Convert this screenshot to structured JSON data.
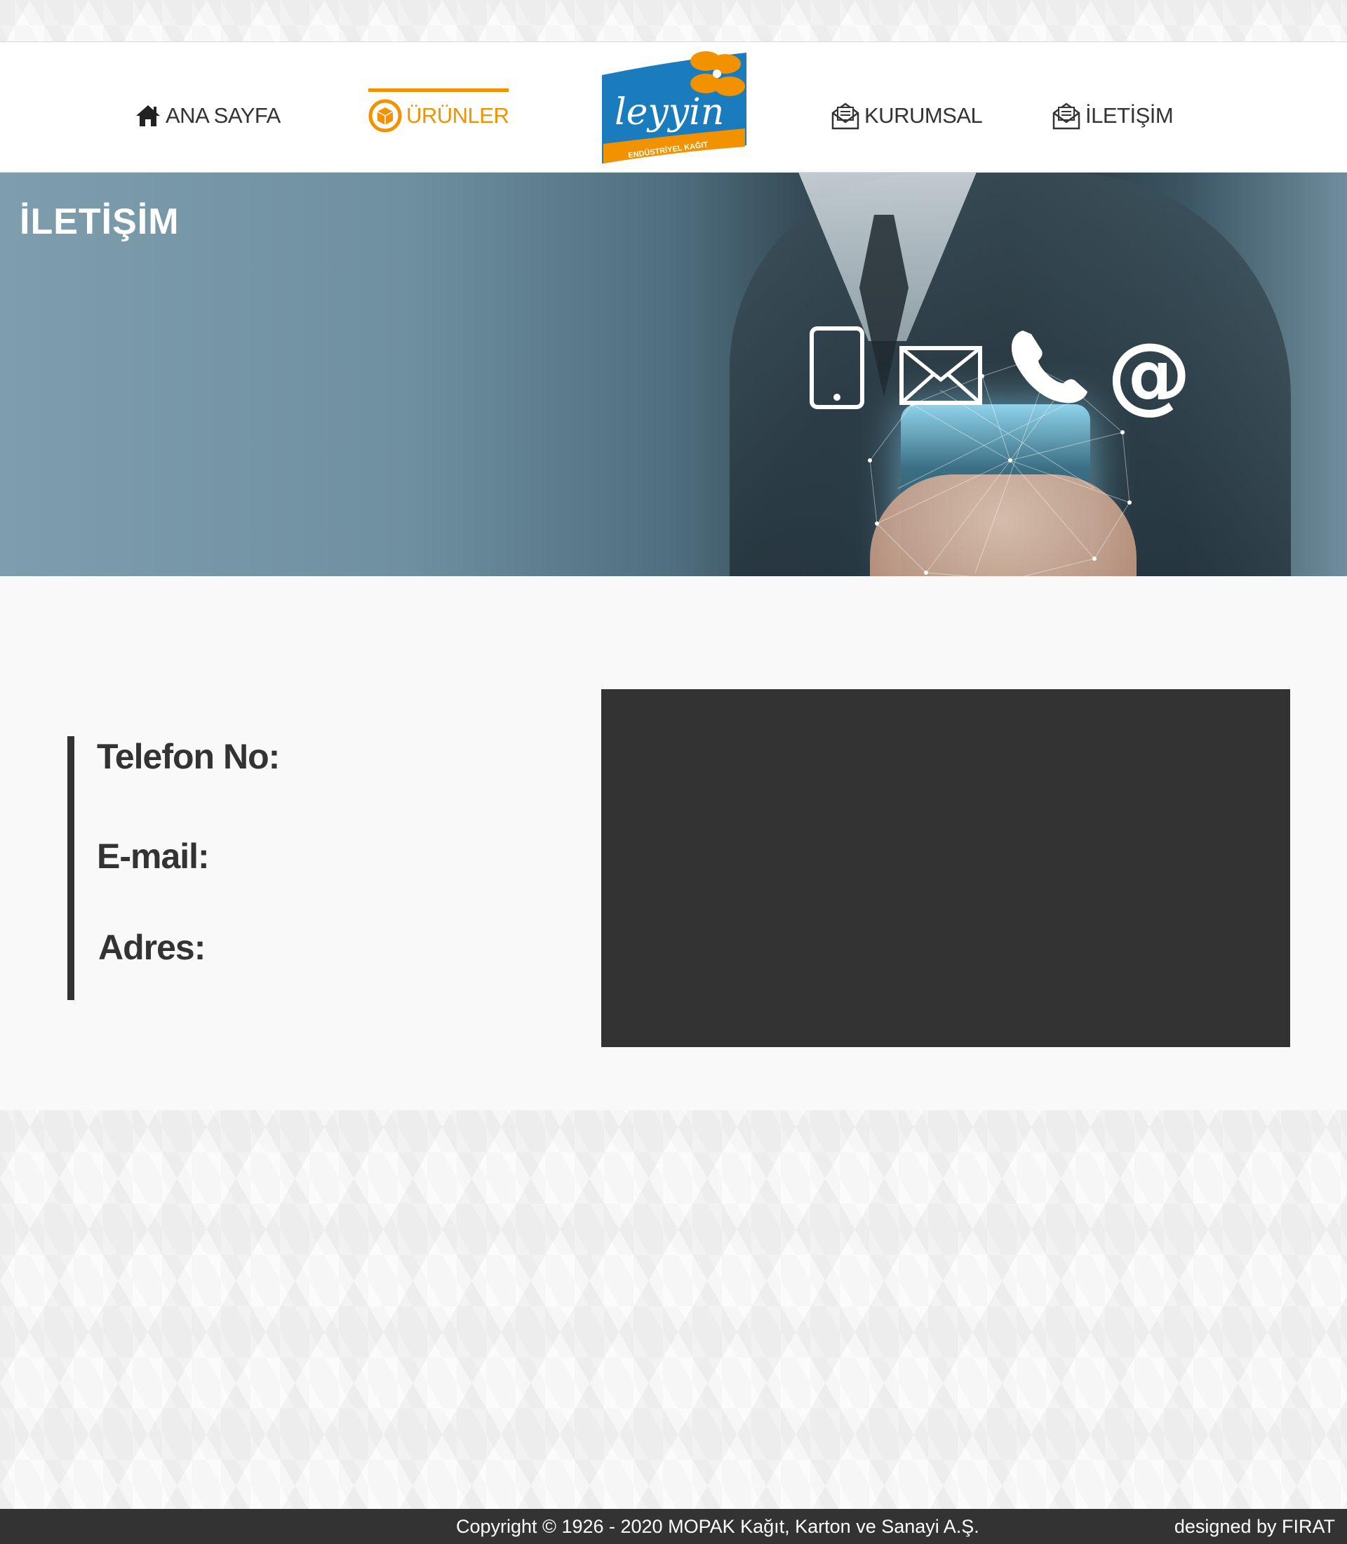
{
  "nav": {
    "home_label": "ANA SAYFA",
    "products_label": "ÜRÜNLER",
    "corporate_label": "KURUMSAL",
    "contact_label": "İLETİŞİM",
    "active": "products",
    "accent_color": "#f39200"
  },
  "logo": {
    "text": "leyyin",
    "subtitle": "ENDÜSTRİYEL KAĞIT"
  },
  "hero": {
    "title": "İLETİŞİM"
  },
  "contact": {
    "phone_label": "Telefon No:",
    "email_label": "E-mail:",
    "address_label": "Adres:"
  },
  "footer": {
    "copyright": "Copyright © 1926 - 2020 MOPAK Kağıt, Karton ve Sanayi A.Ş.",
    "designed_by": "designed by FIRAT"
  },
  "icons": {
    "home": "home-icon",
    "products": "box-icon",
    "corporate": "envelope-open-icon",
    "contact": "envelope-open-icon"
  }
}
